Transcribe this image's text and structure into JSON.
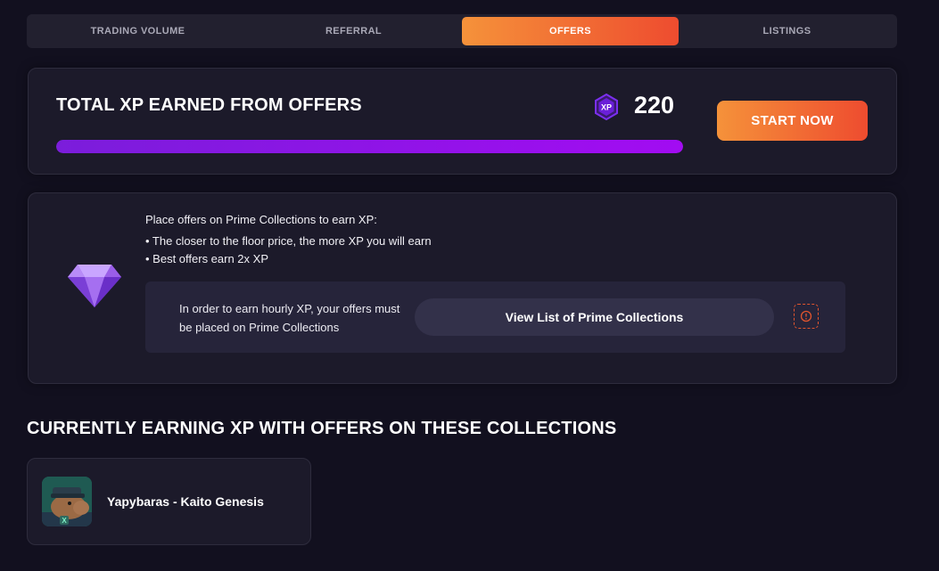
{
  "tabs": [
    {
      "label": "TRADING VOLUME",
      "active": false
    },
    {
      "label": "REFERRAL",
      "active": false
    },
    {
      "label": "OFFERS",
      "active": true
    },
    {
      "label": "LISTINGS",
      "active": false
    }
  ],
  "xp_summary": {
    "title": "TOTAL XP EARNED FROM OFFERS",
    "badge_label": "XP",
    "value": "220",
    "progress_fraction": 1.0,
    "cta_label": "START NOW"
  },
  "info": {
    "intro": "Place offers on Prime Collections to earn XP:",
    "bullets": [
      "• The closer to the floor price, the more XP you will earn",
      "• Best offers earn 2x XP"
    ],
    "notice": "In order to earn hourly XP, your offers must be placed on Prime Collections",
    "view_button": "View List of Prime Collections",
    "info_icon": "info-circle-icon"
  },
  "collections_section": {
    "title": "CURRENTLY EARNING XP WITH OFFERS ON THESE COLLECTIONS",
    "items": [
      {
        "name": "Yapybaras - Kaito Genesis",
        "avatar": "capybara-avatar"
      }
    ]
  },
  "colors": {
    "background": "#12101f",
    "card": "#1c1a2a",
    "accent_start": "#f5923a",
    "accent_end": "#ee4c2f",
    "progress": "#a20cf2",
    "gem": "#a56ff0"
  }
}
